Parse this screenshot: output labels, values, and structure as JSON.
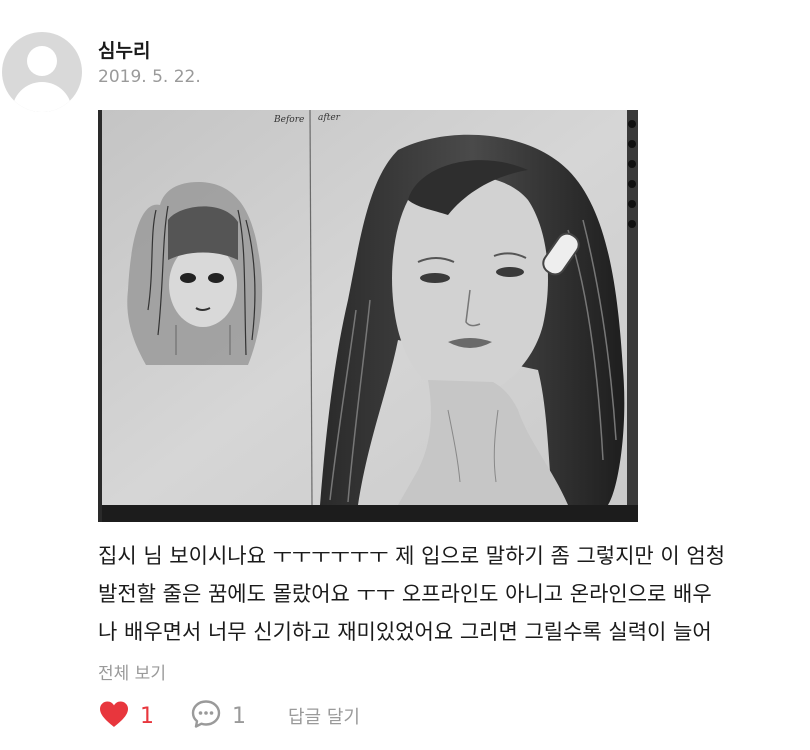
{
  "review": {
    "author": "심누리",
    "date": "2019. 5. 22.",
    "photo": {
      "label_before": "Before",
      "label_after": "after"
    },
    "text_lines": [
      "집시 님 보이시나요 ㅜㅜㅜㅜㅜㅜ 제 입으로 말하기 좀 그렇지만 이 엄청",
      "발전할 줄은 꿈에도 몰랐어요 ㅜㅜ 오프라인도 아니고 온라인으로 배우",
      "나 배우면서 너무 신기하고 재미있었어요 그리면 그릴수록 실력이 늘어"
    ],
    "see_all_label": "전체 보기",
    "like_count": "1",
    "comment_count": "1",
    "reply_label": "답글 달기",
    "like_color": "#e8363d"
  },
  "icons": {
    "avatar": "default-user-icon",
    "like": "heart-icon",
    "comment": "speech-bubble-icon"
  }
}
